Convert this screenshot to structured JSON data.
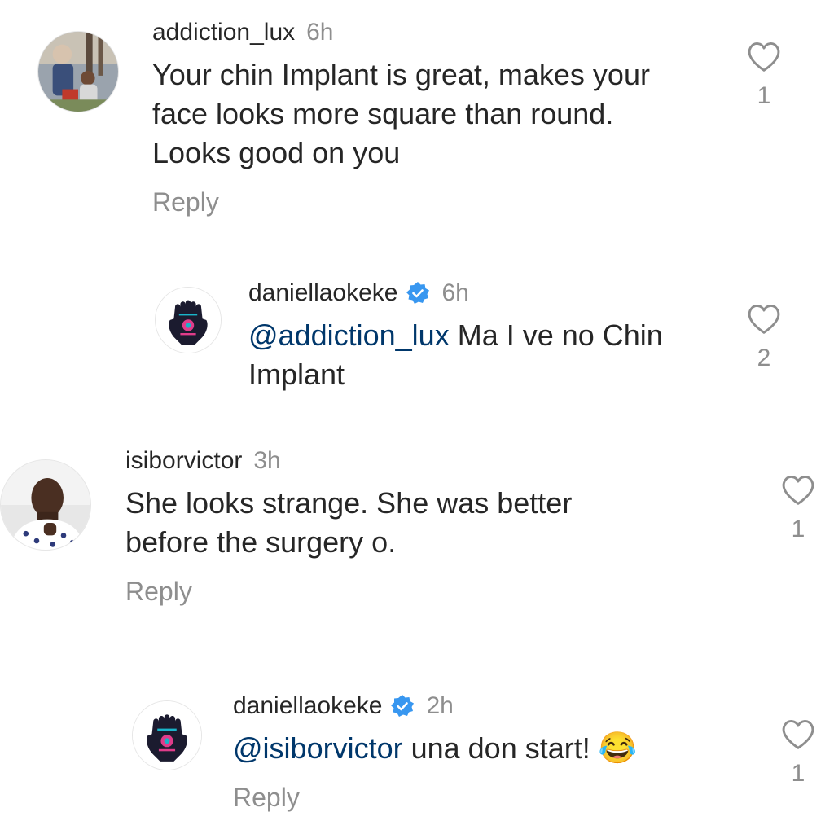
{
  "comments": [
    {
      "username": "addiction_lux",
      "time": "6h",
      "verified": false,
      "mention": "",
      "text_lines": [
        "Your chin Implant is great, makes your",
        "face looks more square than round.",
        "Looks good on you"
      ],
      "reply_label": "Reply",
      "like_count": "1"
    },
    {
      "username": "daniellaokeke",
      "time": "6h",
      "verified": true,
      "mention": "@addiction_lux",
      "text_lines": [
        " Ma I ve no Chin",
        "Implant"
      ],
      "reply_label": "",
      "like_count": "2"
    },
    {
      "username": "isiborvictor",
      "time": "3h",
      "verified": false,
      "mention": "",
      "text_lines": [
        "She looks strange. She was better",
        "before the surgery o."
      ],
      "reply_label": "Reply",
      "like_count": "1"
    },
    {
      "username": "daniellaokeke",
      "time": "2h",
      "verified": true,
      "mention": "@isiborvictor",
      "text_lines": [
        " una don start!"
      ],
      "emoji": "😂",
      "reply_label": "Reply",
      "like_count": "1"
    }
  ],
  "colors": {
    "verified_badge": "#3897f0",
    "mention": "#00376b",
    "secondary_text": "#8e8e8e"
  },
  "icons": {
    "like": "heart-outline-icon",
    "verified": "verified-badge-icon",
    "avatar_brand": "hamsa-hand-icon"
  }
}
